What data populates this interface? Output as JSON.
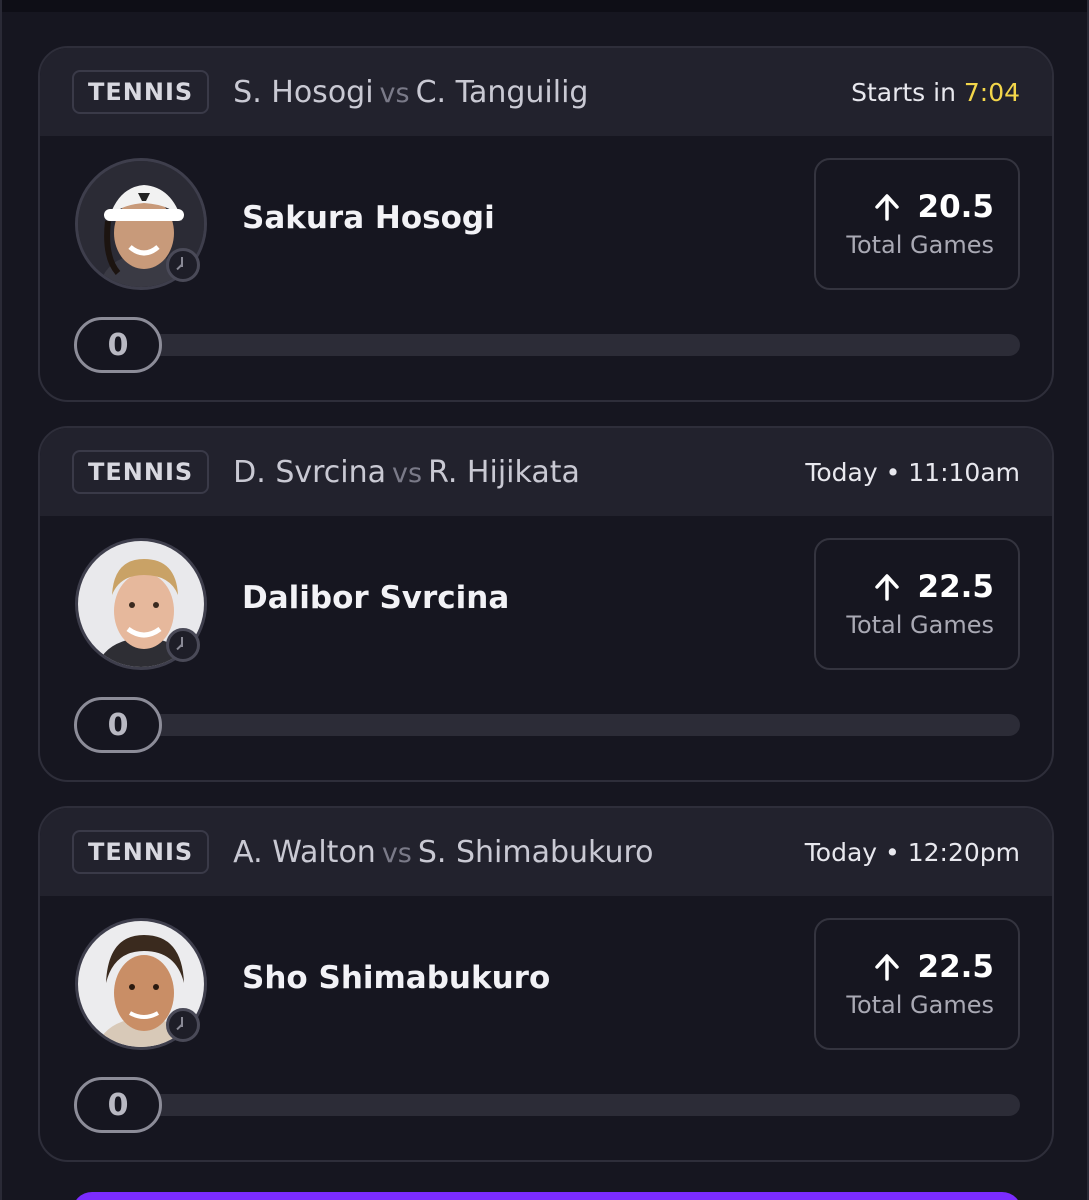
{
  "colors": {
    "background": "#161620",
    "header": "#22222d",
    "countdown": "#f3d64a",
    "accent": "#7b2cff"
  },
  "cards": [
    {
      "sport": "TENNIS",
      "player_a": "S. Hosogi",
      "vs": "vs",
      "player_b": "C. Tanguilig",
      "time_prefix": "Starts in ",
      "time_value": "7:04",
      "player_name": "Sakura Hosogi",
      "avatar_icon": "player-photo",
      "pick_direction": "up-arrow-icon",
      "pick_value": "20.5",
      "pick_label": "Total Games",
      "progress_value": "0"
    },
    {
      "sport": "TENNIS",
      "player_a": "D. Svrcina",
      "vs": "vs",
      "player_b": "R. Hijikata",
      "time_prefix": "Today • 11:10am",
      "time_value": "",
      "player_name": "Dalibor Svrcina",
      "avatar_icon": "player-photo",
      "pick_direction": "up-arrow-icon",
      "pick_value": "22.5",
      "pick_label": "Total Games",
      "progress_value": "0"
    },
    {
      "sport": "TENNIS",
      "player_a": "A. Walton",
      "vs": "vs",
      "player_b": "S. Shimabukuro",
      "time_prefix": "Today • 12:20pm",
      "time_value": "",
      "player_name": "Sho Shimabukuro",
      "avatar_icon": "player-photo",
      "pick_direction": "up-arrow-icon",
      "pick_value": "22.5",
      "pick_label": "Total Games",
      "progress_value": "0"
    }
  ]
}
